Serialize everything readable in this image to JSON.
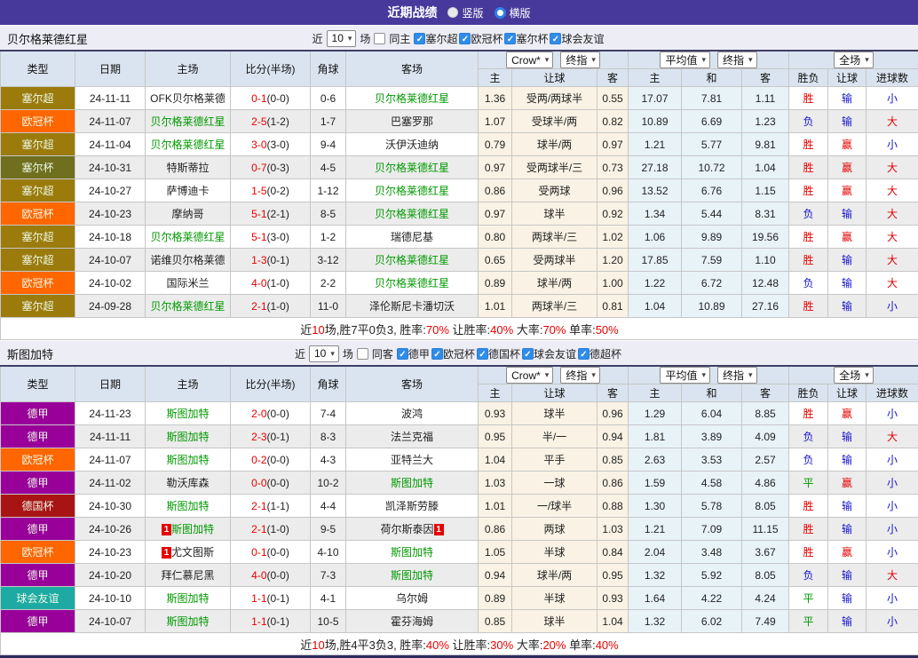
{
  "title_bar": {
    "title": "近期战绩",
    "options": [
      {
        "label": "竖版",
        "selected": false
      },
      {
        "label": "横版",
        "selected": true
      }
    ]
  },
  "table_header": {
    "cols": {
      "type": "类型",
      "date": "日期",
      "home": "主场",
      "score": "比分(半场)",
      "corner": "角球",
      "away": "客场"
    },
    "selects": {
      "bookmaker": "Crow*",
      "bookmaker_stage": "终指",
      "average": "平均值",
      "average_stage": "终指",
      "scope": "全场"
    },
    "sub": {
      "odds_home": "主",
      "handicap": "让球",
      "odds_away": "客",
      "avg_home": "主",
      "avg_draw": "和",
      "avg_away": "客",
      "result_wl": "胜负",
      "result_handicap": "让球",
      "result_goals": "进球数"
    }
  },
  "card_label": "1",
  "league_colors": {
    "塞尔超": "#9a7b0c",
    "欧冠杯": "#ff6600",
    "塞尔杯": "#6f6f1e",
    "德甲": "#990099",
    "德国杯": "#a81414",
    "球会友谊": "#1daaa3"
  },
  "result_colors": {
    "red": "#e60000",
    "blue": "#1414cc",
    "green": "#009900"
  },
  "sections": [
    {
      "team": "贝尔格莱德红星",
      "filter": {
        "near_label": "近",
        "count": "10",
        "games_label": "场",
        "same_label": "同主",
        "same_checked": false,
        "leagues": [
          "塞尔超",
          "欧冠杯",
          "塞尔杯",
          "球会友谊"
        ]
      },
      "rows": [
        {
          "league": "塞尔超",
          "date": "24-11-11",
          "home": "OFK贝尔格莱德",
          "home_team": false,
          "home_card": false,
          "score": "0-1",
          "half": "(0-0)",
          "corner": "0-6",
          "away": "贝尔格莱德红星",
          "away_team": true,
          "away_card": false,
          "odds": [
            "1.36",
            "受两/两球半",
            "0.55"
          ],
          "avg": [
            "17.07",
            "7.81",
            "1.11"
          ],
          "results": [
            [
              "胜",
              "red"
            ],
            [
              "输",
              "blue"
            ],
            [
              "小",
              "blue"
            ]
          ]
        },
        {
          "league": "欧冠杯",
          "date": "24-11-07",
          "home": "贝尔格莱德红星",
          "home_team": true,
          "home_card": false,
          "score": "2-5",
          "half": "(1-2)",
          "corner": "1-7",
          "away": "巴塞罗那",
          "away_team": false,
          "away_card": false,
          "odds": [
            "1.07",
            "受球半/两",
            "0.82"
          ],
          "avg": [
            "10.89",
            "6.69",
            "1.23"
          ],
          "results": [
            [
              "负",
              "blue"
            ],
            [
              "输",
              "blue"
            ],
            [
              "大",
              "red"
            ]
          ]
        },
        {
          "league": "塞尔超",
          "date": "24-11-04",
          "home": "贝尔格莱德红星",
          "home_team": true,
          "home_card": false,
          "score": "3-0",
          "half": "(3-0)",
          "corner": "9-4",
          "away": "沃伊沃迪纳",
          "away_team": false,
          "away_card": false,
          "odds": [
            "0.79",
            "球半/两",
            "0.97"
          ],
          "avg": [
            "1.21",
            "5.77",
            "9.81"
          ],
          "results": [
            [
              "胜",
              "red"
            ],
            [
              "赢",
              "red"
            ],
            [
              "小",
              "blue"
            ]
          ]
        },
        {
          "league": "塞尔杯",
          "date": "24-10-31",
          "home": "特斯蒂拉",
          "home_team": false,
          "home_card": false,
          "score": "0-7",
          "half": "(0-3)",
          "corner": "4-5",
          "away": "贝尔格莱德红星",
          "away_team": true,
          "away_card": false,
          "odds": [
            "0.97",
            "受两球半/三",
            "0.73"
          ],
          "avg": [
            "27.18",
            "10.72",
            "1.04"
          ],
          "results": [
            [
              "胜",
              "red"
            ],
            [
              "赢",
              "red"
            ],
            [
              "大",
              "red"
            ]
          ]
        },
        {
          "league": "塞尔超",
          "date": "24-10-27",
          "home": "萨博迪卡",
          "home_team": false,
          "home_card": false,
          "score": "1-5",
          "half": "(0-2)",
          "corner": "1-12",
          "away": "贝尔格莱德红星",
          "away_team": true,
          "away_card": false,
          "odds": [
            "0.86",
            "受两球",
            "0.96"
          ],
          "avg": [
            "13.52",
            "6.76",
            "1.15"
          ],
          "results": [
            [
              "胜",
              "red"
            ],
            [
              "赢",
              "red"
            ],
            [
              "大",
              "red"
            ]
          ]
        },
        {
          "league": "欧冠杯",
          "date": "24-10-23",
          "home": "摩纳哥",
          "home_team": false,
          "home_card": false,
          "score": "5-1",
          "half": "(2-1)",
          "corner": "8-5",
          "away": "贝尔格莱德红星",
          "away_team": true,
          "away_card": false,
          "odds": [
            "0.97",
            "球半",
            "0.92"
          ],
          "avg": [
            "1.34",
            "5.44",
            "8.31"
          ],
          "results": [
            [
              "负",
              "blue"
            ],
            [
              "输",
              "blue"
            ],
            [
              "大",
              "red"
            ]
          ]
        },
        {
          "league": "塞尔超",
          "date": "24-10-18",
          "home": "贝尔格莱德红星",
          "home_team": true,
          "home_card": false,
          "score": "5-1",
          "half": "(3-0)",
          "corner": "1-2",
          "away": "瑞德尼基",
          "away_team": false,
          "away_card": false,
          "odds": [
            "0.80",
            "两球半/三",
            "1.02"
          ],
          "avg": [
            "1.06",
            "9.89",
            "19.56"
          ],
          "results": [
            [
              "胜",
              "red"
            ],
            [
              "赢",
              "red"
            ],
            [
              "大",
              "red"
            ]
          ]
        },
        {
          "league": "塞尔超",
          "date": "24-10-07",
          "home": "诺维贝尔格莱德",
          "home_team": false,
          "home_card": false,
          "score": "1-3",
          "half": "(0-1)",
          "corner": "3-12",
          "away": "贝尔格莱德红星",
          "away_team": true,
          "away_card": false,
          "odds": [
            "0.65",
            "受两球半",
            "1.20"
          ],
          "avg": [
            "17.85",
            "7.59",
            "1.10"
          ],
          "results": [
            [
              "胜",
              "red"
            ],
            [
              "输",
              "blue"
            ],
            [
              "大",
              "red"
            ]
          ]
        },
        {
          "league": "欧冠杯",
          "date": "24-10-02",
          "home": "国际米兰",
          "home_team": false,
          "home_card": false,
          "score": "4-0",
          "half": "(1-0)",
          "corner": "2-2",
          "away": "贝尔格莱德红星",
          "away_team": true,
          "away_card": false,
          "odds": [
            "0.89",
            "球半/两",
            "1.00"
          ],
          "avg": [
            "1.22",
            "6.72",
            "12.48"
          ],
          "results": [
            [
              "负",
              "blue"
            ],
            [
              "输",
              "blue"
            ],
            [
              "大",
              "red"
            ]
          ]
        },
        {
          "league": "塞尔超",
          "date": "24-09-28",
          "home": "贝尔格莱德红星",
          "home_team": true,
          "home_card": false,
          "score": "2-1",
          "half": "(1-0)",
          "corner": "11-0",
          "away": "泽伦斯尼卡潘切沃",
          "away_team": false,
          "away_card": false,
          "odds": [
            "1.01",
            "两球半/三",
            "0.81"
          ],
          "avg": [
            "1.04",
            "10.89",
            "27.16"
          ],
          "results": [
            [
              "胜",
              "red"
            ],
            [
              "输",
              "blue"
            ],
            [
              "小",
              "blue"
            ]
          ]
        }
      ],
      "summary": [
        [
          "近",
          0
        ],
        [
          "10",
          1
        ],
        [
          "场,胜7平0负3, 胜率:",
          0
        ],
        [
          "70%",
          1
        ],
        [
          " 让胜率:",
          0
        ],
        [
          "40%",
          1
        ],
        [
          " 大率:",
          0
        ],
        [
          "70%",
          1
        ],
        [
          " 单率:",
          0
        ],
        [
          "50%",
          1
        ]
      ]
    },
    {
      "team": "斯图加特",
      "filter": {
        "near_label": "近",
        "count": "10",
        "games_label": "场",
        "same_label": "同客",
        "same_checked": false,
        "leagues": [
          "德甲",
          "欧冠杯",
          "德国杯",
          "球会友谊",
          "德超杯"
        ]
      },
      "rows": [
        {
          "league": "德甲",
          "date": "24-11-23",
          "home": "斯图加特",
          "home_team": true,
          "home_card": false,
          "score": "2-0",
          "half": "(0-0)",
          "corner": "7-4",
          "away": "波鸿",
          "away_team": false,
          "away_card": false,
          "odds": [
            "0.93",
            "球半",
            "0.96"
          ],
          "avg": [
            "1.29",
            "6.04",
            "8.85"
          ],
          "results": [
            [
              "胜",
              "red"
            ],
            [
              "赢",
              "red"
            ],
            [
              "小",
              "blue"
            ]
          ]
        },
        {
          "league": "德甲",
          "date": "24-11-11",
          "home": "斯图加特",
          "home_team": true,
          "home_card": false,
          "score": "2-3",
          "half": "(0-1)",
          "corner": "8-3",
          "away": "法兰克福",
          "away_team": false,
          "away_card": false,
          "odds": [
            "0.95",
            "半/一",
            "0.94"
          ],
          "avg": [
            "1.81",
            "3.89",
            "4.09"
          ],
          "results": [
            [
              "负",
              "blue"
            ],
            [
              "输",
              "blue"
            ],
            [
              "大",
              "red"
            ]
          ]
        },
        {
          "league": "欧冠杯",
          "date": "24-11-07",
          "home": "斯图加特",
          "home_team": true,
          "home_card": false,
          "score": "0-2",
          "half": "(0-0)",
          "corner": "4-3",
          "away": "亚特兰大",
          "away_team": false,
          "away_card": false,
          "odds": [
            "1.04",
            "平手",
            "0.85"
          ],
          "avg": [
            "2.63",
            "3.53",
            "2.57"
          ],
          "results": [
            [
              "负",
              "blue"
            ],
            [
              "输",
              "blue"
            ],
            [
              "小",
              "blue"
            ]
          ]
        },
        {
          "league": "德甲",
          "date": "24-11-02",
          "home": "勒沃库森",
          "home_team": false,
          "home_card": false,
          "score": "0-0",
          "half": "(0-0)",
          "corner": "10-2",
          "away": "斯图加特",
          "away_team": true,
          "away_card": false,
          "odds": [
            "1.03",
            "一球",
            "0.86"
          ],
          "avg": [
            "1.59",
            "4.58",
            "4.86"
          ],
          "results": [
            [
              "平",
              "green"
            ],
            [
              "赢",
              "red"
            ],
            [
              "小",
              "blue"
            ]
          ]
        },
        {
          "league": "德国杯",
          "date": "24-10-30",
          "home": "斯图加特",
          "home_team": true,
          "home_card": false,
          "score": "2-1",
          "half": "(1-1)",
          "corner": "4-4",
          "away": "凯泽斯劳滕",
          "away_team": false,
          "away_card": false,
          "odds": [
            "1.01",
            "一/球半",
            "0.88"
          ],
          "avg": [
            "1.30",
            "5.78",
            "8.05"
          ],
          "results": [
            [
              "胜",
              "red"
            ],
            [
              "输",
              "blue"
            ],
            [
              "小",
              "blue"
            ]
          ]
        },
        {
          "league": "德甲",
          "date": "24-10-26",
          "home": "斯图加特",
          "home_team": true,
          "home_card": true,
          "score": "2-1",
          "half": "(1-0)",
          "corner": "9-5",
          "away": "荷尔斯泰因",
          "away_team": false,
          "away_card": true,
          "odds": [
            "0.86",
            "两球",
            "1.03"
          ],
          "avg": [
            "1.21",
            "7.09",
            "11.15"
          ],
          "results": [
            [
              "胜",
              "red"
            ],
            [
              "输",
              "blue"
            ],
            [
              "小",
              "blue"
            ]
          ]
        },
        {
          "league": "欧冠杯",
          "date": "24-10-23",
          "home": "尤文图斯",
          "home_team": false,
          "home_card": true,
          "score": "0-1",
          "half": "(0-0)",
          "corner": "4-10",
          "away": "斯图加特",
          "away_team": true,
          "away_card": false,
          "odds": [
            "1.05",
            "半球",
            "0.84"
          ],
          "avg": [
            "2.04",
            "3.48",
            "3.67"
          ],
          "results": [
            [
              "胜",
              "red"
            ],
            [
              "赢",
              "red"
            ],
            [
              "小",
              "blue"
            ]
          ]
        },
        {
          "league": "德甲",
          "date": "24-10-20",
          "home": "拜仁慕尼黑",
          "home_team": false,
          "home_card": false,
          "score": "4-0",
          "half": "(0-0)",
          "corner": "7-3",
          "away": "斯图加特",
          "away_team": true,
          "away_card": false,
          "odds": [
            "0.94",
            "球半/两",
            "0.95"
          ],
          "avg": [
            "1.32",
            "5.92",
            "8.05"
          ],
          "results": [
            [
              "负",
              "blue"
            ],
            [
              "输",
              "blue"
            ],
            [
              "大",
              "red"
            ]
          ]
        },
        {
          "league": "球会友谊",
          "date": "24-10-10",
          "home": "斯图加特",
          "home_team": true,
          "home_card": false,
          "score": "1-1",
          "half": "(0-1)",
          "corner": "4-1",
          "away": "乌尔姆",
          "away_team": false,
          "away_card": false,
          "odds": [
            "0.89",
            "半球",
            "0.93"
          ],
          "avg": [
            "1.64",
            "4.22",
            "4.24"
          ],
          "results": [
            [
              "平",
              "green"
            ],
            [
              "输",
              "blue"
            ],
            [
              "小",
              "blue"
            ]
          ]
        },
        {
          "league": "德甲",
          "date": "24-10-07",
          "home": "斯图加特",
          "home_team": true,
          "home_card": false,
          "score": "1-1",
          "half": "(0-1)",
          "corner": "10-5",
          "away": "霍芬海姆",
          "away_team": false,
          "away_card": false,
          "odds": [
            "0.85",
            "球半",
            "1.04"
          ],
          "avg": [
            "1.32",
            "6.02",
            "7.49"
          ],
          "results": [
            [
              "平",
              "green"
            ],
            [
              "输",
              "blue"
            ],
            [
              "小",
              "blue"
            ]
          ]
        }
      ],
      "summary": [
        [
          "近",
          0
        ],
        [
          "10",
          1
        ],
        [
          "场,胜4平3负3, 胜率:",
          0
        ],
        [
          "40%",
          1
        ],
        [
          " 让胜率:",
          0
        ],
        [
          "30%",
          1
        ],
        [
          " 大率:",
          0
        ],
        [
          "20%",
          1
        ],
        [
          " 单率:",
          0
        ],
        [
          "40%",
          1
        ]
      ]
    }
  ]
}
